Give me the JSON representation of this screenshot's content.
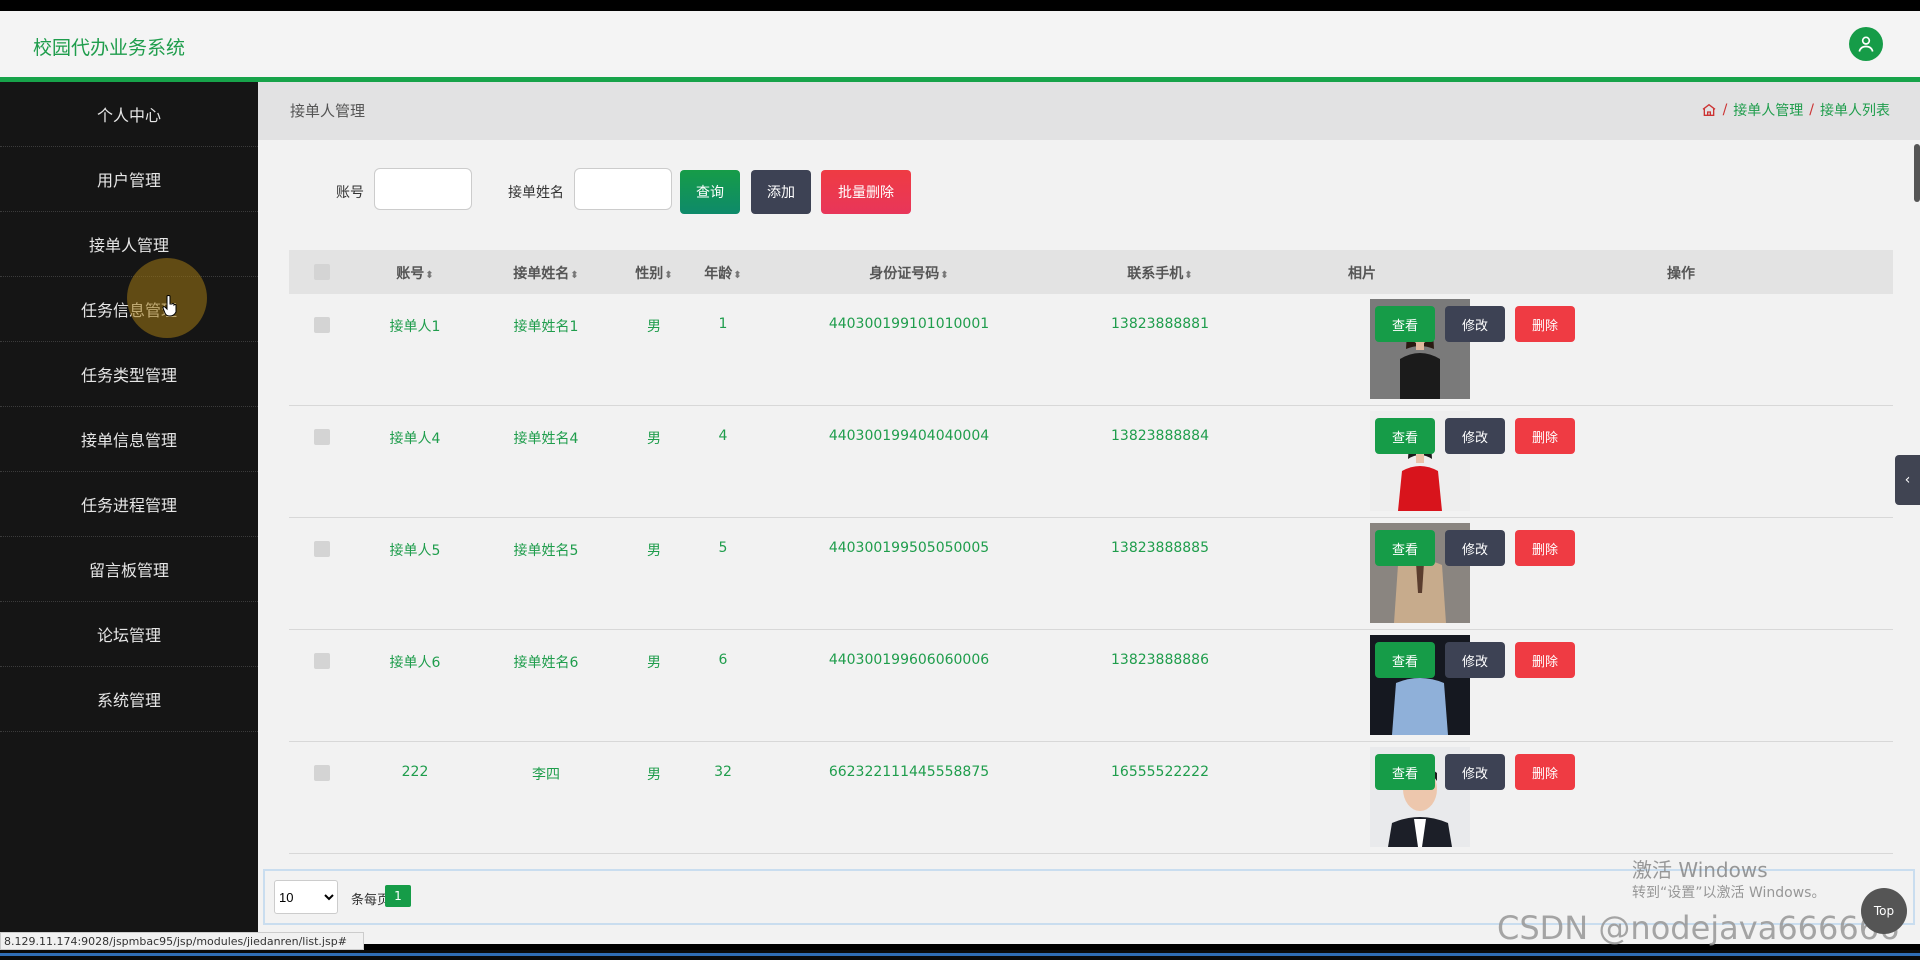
{
  "header": {
    "title": "校园代办业务系统"
  },
  "sidebar": {
    "items": [
      {
        "label": "个人中心"
      },
      {
        "label": "用户管理"
      },
      {
        "label": "接单人管理"
      },
      {
        "label": "任务信息管理"
      },
      {
        "label": "任务类型管理"
      },
      {
        "label": "接单信息管理"
      },
      {
        "label": "任务进程管理"
      },
      {
        "label": "留言板管理"
      },
      {
        "label": "论坛管理"
      },
      {
        "label": "系统管理"
      }
    ]
  },
  "breadcrumb": {
    "title": "接单人管理",
    "sep": "/",
    "level1": "接单人管理",
    "level2": "接单人列表"
  },
  "search": {
    "account_label": "账号",
    "name_label": "接单姓名",
    "account_value": "",
    "name_value": "",
    "query_button": "查询",
    "add_button": "添加",
    "batch_delete_button": "批量删除"
  },
  "table": {
    "columns": [
      "账号",
      "接单姓名",
      "性别",
      "年龄",
      "身份证号码",
      "联系手机",
      "相片",
      "操作"
    ],
    "sort_icon": "⬍",
    "rows": [
      {
        "account": "接单人1",
        "name": "接单姓名1",
        "gender": "男",
        "age": "1",
        "id_number": "440300199101010001",
        "phone": "13823888881",
        "photo": "woman-black-suit"
      },
      {
        "account": "接单人4",
        "name": "接单姓名4",
        "gender": "男",
        "age": "4",
        "id_number": "440300199404040004",
        "phone": "13823888884",
        "photo": "woman-red-dress"
      },
      {
        "account": "接单人5",
        "name": "接单姓名5",
        "gender": "男",
        "age": "5",
        "id_number": "440300199505050005",
        "phone": "13823888885",
        "photo": "man-beige-suit"
      },
      {
        "account": "接单人6",
        "name": "接单姓名6",
        "gender": "男",
        "age": "6",
        "id_number": "440300199606060006",
        "phone": "13823888886",
        "photo": "man-blue-shirt"
      },
      {
        "account": "222",
        "name": "李四",
        "gender": "男",
        "age": "32",
        "id_number": "662322111445558875",
        "phone": "16555522222",
        "photo": "man-portrait"
      }
    ],
    "action_view": "查看",
    "action_edit": "修改",
    "action_delete": "删除"
  },
  "pager": {
    "page_size": "10",
    "page_size_options": [
      "10"
    ],
    "per_page_label": "条每页",
    "current_page": "1"
  },
  "status_bar": {
    "url": "8.129.11.174:9028/jspmbac95/jsp/modules/jiedanren/list.jsp#"
  },
  "overlay": {
    "activate_windows": "激活 Windows",
    "activate_hint": "转到“设置”以激活 Windows。",
    "csdn": "CSDN @nodejava666666",
    "top_button": "Top"
  },
  "colors": {
    "accent": "#1f9d4c",
    "sidebar": "#151515",
    "edit": "#3d4254",
    "delete": "#ef3b43"
  }
}
